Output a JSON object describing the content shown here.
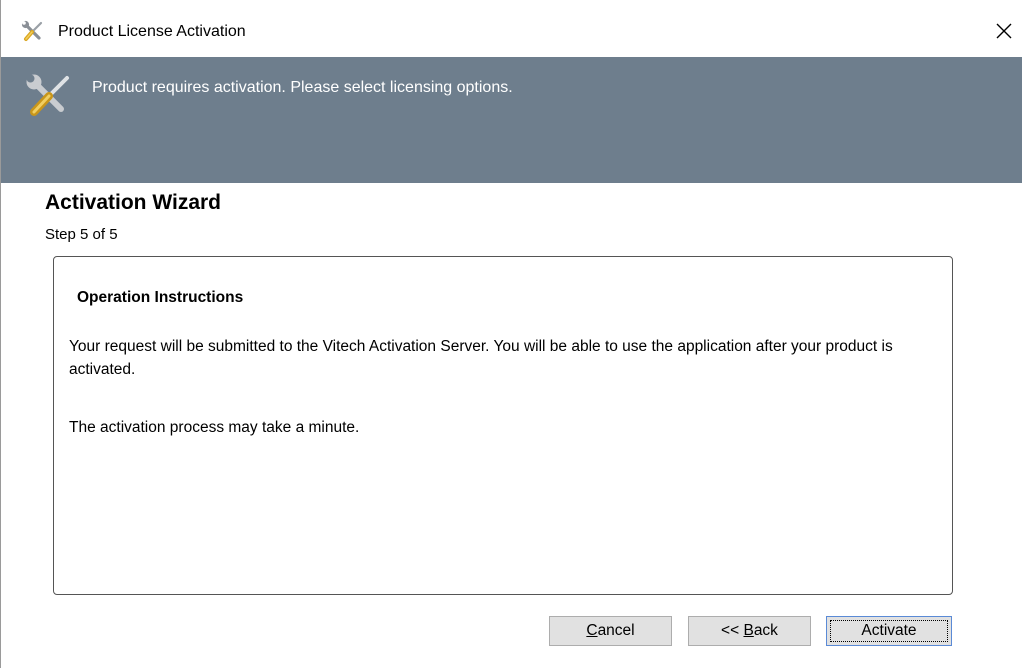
{
  "window": {
    "title": "Product License Activation",
    "icons": {
      "app": "tools-icon",
      "close": "close-icon"
    }
  },
  "banner": {
    "message": "Product requires activation. Please select licensing options.",
    "icon": "tools-icon",
    "background": "#6e7e8d"
  },
  "wizard": {
    "title": "Activation Wizard",
    "step": "Step 5 of 5"
  },
  "panel": {
    "heading": "Operation Instructions",
    "paragraph1": "Your request will be submitted to the Vitech Activation Server. You will be able to use the application after your product is activated.",
    "paragraph2": "The activation process may take a minute."
  },
  "buttons": {
    "cancel": {
      "pre": "",
      "mnemonic": "C",
      "post": "ancel"
    },
    "back": {
      "pre": "<< ",
      "mnemonic": "B",
      "post": "ack"
    },
    "activate": "Activate"
  }
}
